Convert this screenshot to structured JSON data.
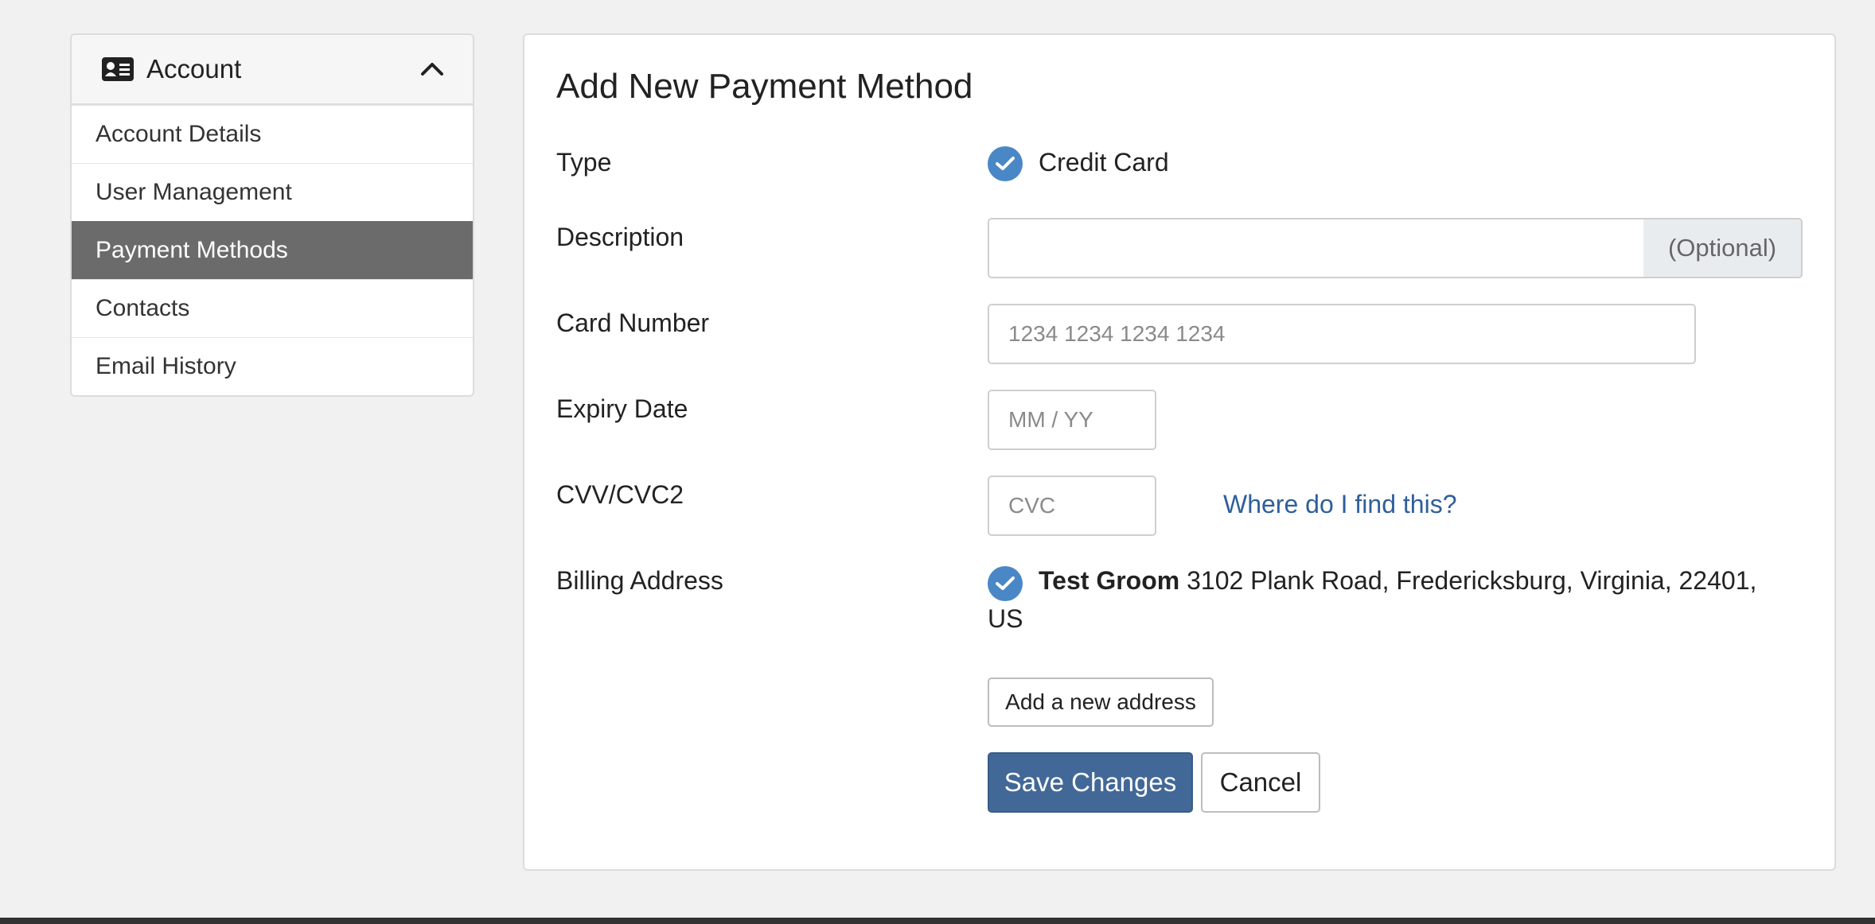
{
  "sidebar": {
    "title": "Account",
    "items": [
      {
        "label": "Account Details"
      },
      {
        "label": "User Management"
      },
      {
        "label": "Payment Methods"
      },
      {
        "label": "Contacts"
      },
      {
        "label": "Email History"
      }
    ],
    "active_index": 2
  },
  "form": {
    "title": "Add New Payment Method",
    "type": {
      "label": "Type",
      "value": "Credit Card"
    },
    "description": {
      "label": "Description",
      "value": "",
      "addon": "(Optional)"
    },
    "card_number": {
      "label": "Card Number",
      "placeholder": "1234 1234 1234 1234",
      "value": ""
    },
    "expiry": {
      "label": "Expiry Date",
      "placeholder": "MM / YY",
      "value": ""
    },
    "cvc": {
      "label": "CVV/CVC2",
      "placeholder": "CVC",
      "value": "",
      "help_link": "Where do I find this?"
    },
    "billing": {
      "label": "Billing Address",
      "name": "Test Groom",
      "address_line": "3102 Plank Road, Fredericksburg, Virginia, 22401,",
      "country": "US",
      "add_address_label": "Add a new address"
    },
    "save_label": "Save Changes",
    "cancel_label": "Cancel"
  },
  "colors": {
    "accent": "#4a87c6",
    "primary_button": "#426897",
    "active_nav": "#6b6b6b",
    "link": "#2f5f9a"
  }
}
